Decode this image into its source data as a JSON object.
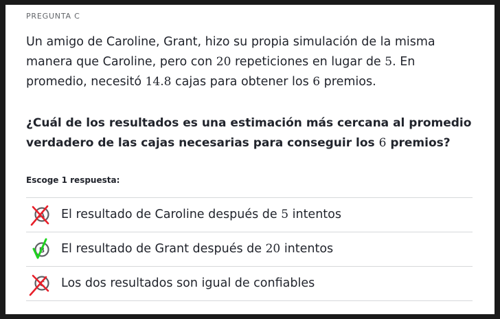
{
  "header": {
    "eyebrow": "PREGUNTA C"
  },
  "body": {
    "p1_a": "Un amigo de Caroline, Grant, hizo su propia simulación de la misma manera que Caroline, pero con ",
    "p1_n20": "20",
    "p1_b": " repeticiones en lugar de ",
    "p1_n5": "5",
    "p1_c": ". En promedio, necesitó ",
    "p1_n148": "14.8",
    "p1_d": " cajas para obtener los ",
    "p1_n6": "6",
    "p1_e": " premios."
  },
  "question": {
    "q_a": "¿Cuál de los resultados es una estimación más cercana al promedio verdadero de las cajas necesarias para conseguir los ",
    "q_n6": "6",
    "q_b": " premios?"
  },
  "instruction": "Escoge 1 respuesta:",
  "choices": [
    {
      "pre": "El resultado de Caroline después de ",
      "num": "5",
      "post": " intentos",
      "status": "incorrect",
      "mark_icon": "red-x-icon"
    },
    {
      "pre": "El resultado de Grant después de ",
      "num": "20",
      "post": " intentos",
      "status": "correct",
      "mark_icon": "green-check-icon"
    },
    {
      "pre": "Los dos resultados son igual de confiables",
      "num": "",
      "post": "",
      "status": "incorrect",
      "mark_icon": "red-x-icon"
    }
  ],
  "colors": {
    "text": "#21242c",
    "muted": "#626569",
    "divider": "#d6d8da",
    "incorrect_mark": "#e8202a",
    "correct_mark": "#1fd41f",
    "radio_gray": "#5d6064"
  }
}
